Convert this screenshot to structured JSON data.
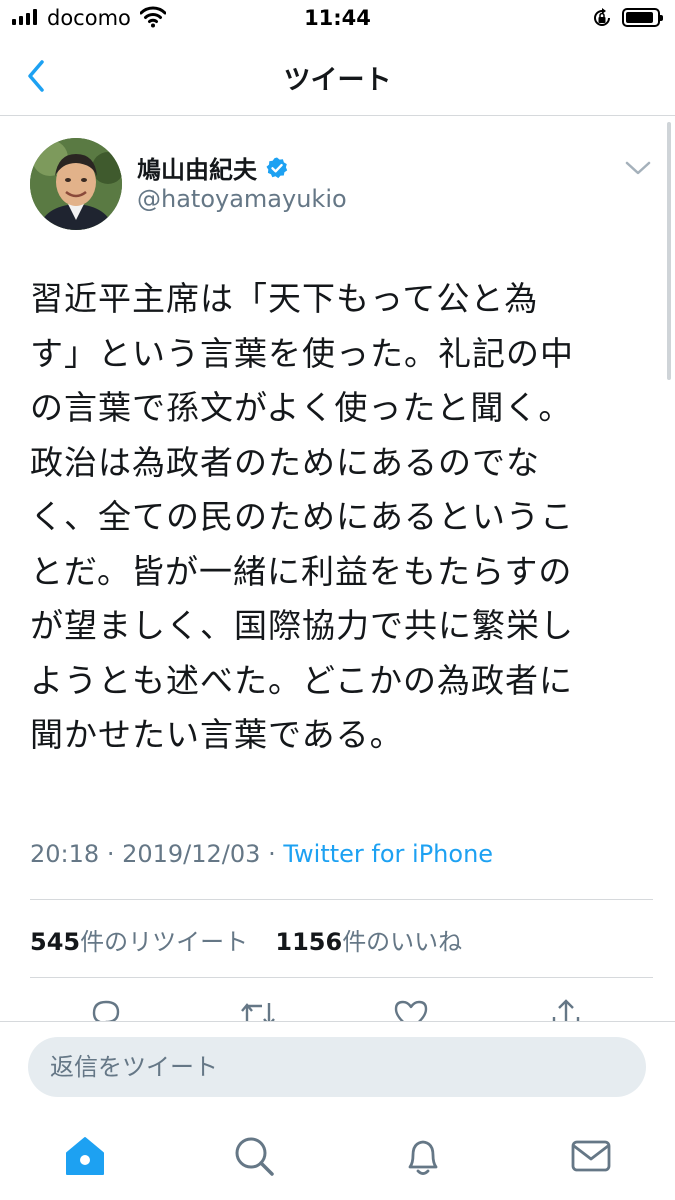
{
  "status_bar": {
    "carrier": "docomo",
    "time": "11:44",
    "battery_level": 0.9
  },
  "nav": {
    "title": "ツイート"
  },
  "tweet": {
    "author_name": "鳩山由紀夫",
    "handle": "@hatoyamayukio",
    "verified": true,
    "text_lines": [
      "習近平主席は「天下もって公と為",
      "す」という言葉を使った。礼記の中",
      "の言葉で孫文がよく使ったと聞く。",
      "政治は為政者のためにあるのでな",
      "く、全ての民のためにあるというこ",
      "とだ。皆が一緒に利益をもたらすの",
      "が望ましく、国際協力で共に繁栄し",
      "ようとも述べた。どこかの為政者に",
      "聞かせたい言葉である。"
    ],
    "time": "20:18",
    "separator": "·",
    "date": "2019/12/03",
    "source": "Twitter for iPhone",
    "retweet_count": "545",
    "retweet_label": "件のリツイート",
    "like_count": "1156",
    "like_label": "件のいいね"
  },
  "reply": {
    "placeholder": "返信をツイート"
  },
  "tab_bar": {
    "icons": [
      "home-icon",
      "search-icon",
      "notifications-icon",
      "messages-icon"
    ],
    "active_color": "#1da1f2",
    "inactive_color": "#657786"
  },
  "colors": {
    "accent": "#1da1f2",
    "secondary_text": "#657786",
    "divider": "#d6d9dc"
  }
}
